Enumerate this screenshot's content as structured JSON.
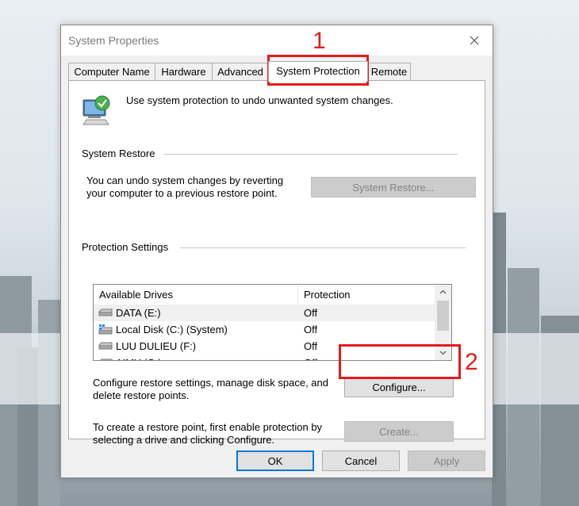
{
  "window": {
    "title": "System Properties",
    "tabs": [
      {
        "label": "Computer Name"
      },
      {
        "label": "Hardware"
      },
      {
        "label": "Advanced"
      },
      {
        "label": "System Protection",
        "active": true
      },
      {
        "label": "Remote"
      }
    ]
  },
  "intro": {
    "text": "Use system protection to undo unwanted system changes."
  },
  "system_restore": {
    "heading": "System Restore",
    "description_line1": "You can undo system changes by reverting",
    "description_line2": "your computer to a previous restore point.",
    "button_label": "System Restore..."
  },
  "protection": {
    "heading": "Protection Settings",
    "columns": [
      "Available Drives",
      "Protection"
    ],
    "drives": [
      {
        "name": "DATA (E:)",
        "protection": "Off",
        "icon": "drive-icon",
        "selected": true
      },
      {
        "name": "Local Disk (C:) (System)",
        "protection": "Off",
        "icon": "system-drive-icon"
      },
      {
        "name": "LUU DULIEU (F:)",
        "protection": "Off",
        "icon": "drive-icon"
      },
      {
        "name": "AIMY (G:)",
        "protection": "Off",
        "icon": "drive-icon"
      }
    ],
    "configure_line1": "Configure restore settings, manage disk space, and",
    "configure_line2": "delete restore points.",
    "configure_label": "Configure...",
    "create_line1": "To create a restore point, first enable protection by",
    "create_line2": "selecting a drive and clicking Configure.",
    "create_label": "Create..."
  },
  "footer": {
    "ok": "OK",
    "cancel": "Cancel",
    "apply": "Apply"
  },
  "annotations": {
    "marker1": "1",
    "marker2": "2",
    "color": "#e31b1b"
  }
}
